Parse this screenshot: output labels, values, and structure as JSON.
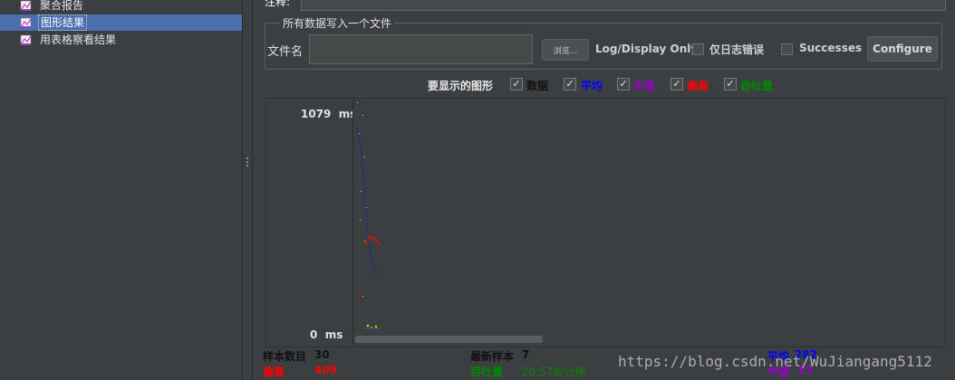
{
  "tree": {
    "items": [
      {
        "label": "聚合报告",
        "selected": false
      },
      {
        "label": "图形结果",
        "selected": true
      },
      {
        "label": "用表格察看结果",
        "selected": false
      }
    ]
  },
  "header": {
    "comment_label": "注释:"
  },
  "file_section": {
    "legend": "所有数据写入一个文件",
    "filename_label": "文件名",
    "filename_value": "",
    "browse_label": "浏览...",
    "log_display_label": "Log/Display Only:",
    "errors_only_label": "仅日志错误",
    "successes_label": "Successes",
    "configure_label": "Configure"
  },
  "display_options": {
    "label": "要显示的图形",
    "options": [
      {
        "label": "数据",
        "checked": true,
        "color": "#111111"
      },
      {
        "label": "平均",
        "checked": true,
        "color": "#0000ff"
      },
      {
        "label": "中值",
        "checked": true,
        "color": "#9900cc"
      },
      {
        "label": "偏离",
        "checked": true,
        "color": "#ff0000"
      },
      {
        "label": "吞吐量",
        "checked": true,
        "color": "#008800"
      }
    ]
  },
  "graph": {
    "y_max_label": "1079",
    "y_min_label": "0",
    "unit": "ms"
  },
  "stats": {
    "sample_count_label": "样本数目",
    "sample_count_value": "30",
    "latest_sample_label": "最新样本",
    "latest_sample_value": "7",
    "average_label": "平均",
    "average_value": "282",
    "deviation_label": "偏离",
    "deviation_value": "409",
    "throughput_label": "吞吐量",
    "throughput_value": "20,579/分钟",
    "median_label": "中值",
    "median_value": "13"
  },
  "watermark": "https://blog.csdn.net/WuJiangang5112",
  "colors": {
    "data": "#111111",
    "average": "#0000ff",
    "median": "#9900cc",
    "deviation": "#ff0000",
    "throughput": "#008800",
    "selection": "#4b6eaf"
  }
}
